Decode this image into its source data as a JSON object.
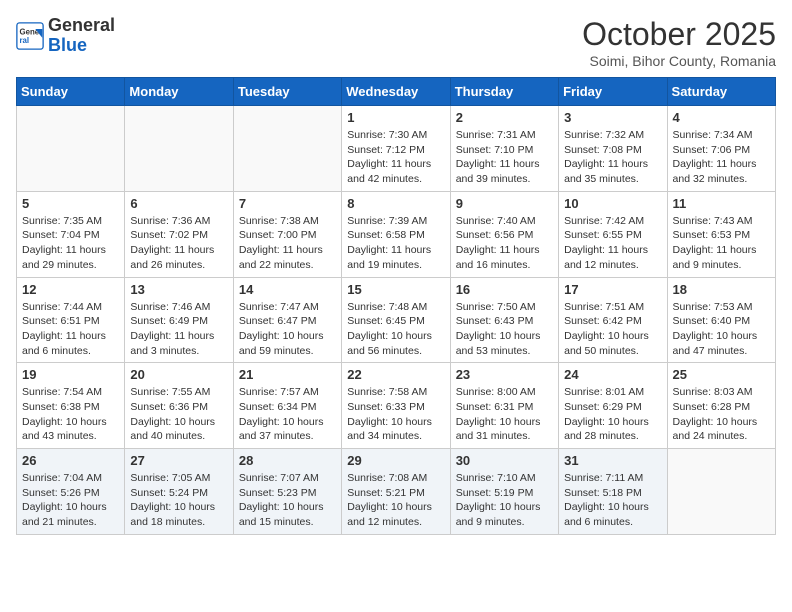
{
  "header": {
    "logo_general": "General",
    "logo_blue": "Blue",
    "month_title": "October 2025",
    "subtitle": "Soimi, Bihor County, Romania"
  },
  "weekdays": [
    "Sunday",
    "Monday",
    "Tuesday",
    "Wednesday",
    "Thursday",
    "Friday",
    "Saturday"
  ],
  "weeks": [
    [
      {
        "day": "",
        "info": ""
      },
      {
        "day": "",
        "info": ""
      },
      {
        "day": "",
        "info": ""
      },
      {
        "day": "1",
        "info": "Sunrise: 7:30 AM\nSunset: 7:12 PM\nDaylight: 11 hours\nand 42 minutes."
      },
      {
        "day": "2",
        "info": "Sunrise: 7:31 AM\nSunset: 7:10 PM\nDaylight: 11 hours\nand 39 minutes."
      },
      {
        "day": "3",
        "info": "Sunrise: 7:32 AM\nSunset: 7:08 PM\nDaylight: 11 hours\nand 35 minutes."
      },
      {
        "day": "4",
        "info": "Sunrise: 7:34 AM\nSunset: 7:06 PM\nDaylight: 11 hours\nand 32 minutes."
      }
    ],
    [
      {
        "day": "5",
        "info": "Sunrise: 7:35 AM\nSunset: 7:04 PM\nDaylight: 11 hours\nand 29 minutes."
      },
      {
        "day": "6",
        "info": "Sunrise: 7:36 AM\nSunset: 7:02 PM\nDaylight: 11 hours\nand 26 minutes."
      },
      {
        "day": "7",
        "info": "Sunrise: 7:38 AM\nSunset: 7:00 PM\nDaylight: 11 hours\nand 22 minutes."
      },
      {
        "day": "8",
        "info": "Sunrise: 7:39 AM\nSunset: 6:58 PM\nDaylight: 11 hours\nand 19 minutes."
      },
      {
        "day": "9",
        "info": "Sunrise: 7:40 AM\nSunset: 6:56 PM\nDaylight: 11 hours\nand 16 minutes."
      },
      {
        "day": "10",
        "info": "Sunrise: 7:42 AM\nSunset: 6:55 PM\nDaylight: 11 hours\nand 12 minutes."
      },
      {
        "day": "11",
        "info": "Sunrise: 7:43 AM\nSunset: 6:53 PM\nDaylight: 11 hours\nand 9 minutes."
      }
    ],
    [
      {
        "day": "12",
        "info": "Sunrise: 7:44 AM\nSunset: 6:51 PM\nDaylight: 11 hours\nand 6 minutes."
      },
      {
        "day": "13",
        "info": "Sunrise: 7:46 AM\nSunset: 6:49 PM\nDaylight: 11 hours\nand 3 minutes."
      },
      {
        "day": "14",
        "info": "Sunrise: 7:47 AM\nSunset: 6:47 PM\nDaylight: 10 hours\nand 59 minutes."
      },
      {
        "day": "15",
        "info": "Sunrise: 7:48 AM\nSunset: 6:45 PM\nDaylight: 10 hours\nand 56 minutes."
      },
      {
        "day": "16",
        "info": "Sunrise: 7:50 AM\nSunset: 6:43 PM\nDaylight: 10 hours\nand 53 minutes."
      },
      {
        "day": "17",
        "info": "Sunrise: 7:51 AM\nSunset: 6:42 PM\nDaylight: 10 hours\nand 50 minutes."
      },
      {
        "day": "18",
        "info": "Sunrise: 7:53 AM\nSunset: 6:40 PM\nDaylight: 10 hours\nand 47 minutes."
      }
    ],
    [
      {
        "day": "19",
        "info": "Sunrise: 7:54 AM\nSunset: 6:38 PM\nDaylight: 10 hours\nand 43 minutes."
      },
      {
        "day": "20",
        "info": "Sunrise: 7:55 AM\nSunset: 6:36 PM\nDaylight: 10 hours\nand 40 minutes."
      },
      {
        "day": "21",
        "info": "Sunrise: 7:57 AM\nSunset: 6:34 PM\nDaylight: 10 hours\nand 37 minutes."
      },
      {
        "day": "22",
        "info": "Sunrise: 7:58 AM\nSunset: 6:33 PM\nDaylight: 10 hours\nand 34 minutes."
      },
      {
        "day": "23",
        "info": "Sunrise: 8:00 AM\nSunset: 6:31 PM\nDaylight: 10 hours\nand 31 minutes."
      },
      {
        "day": "24",
        "info": "Sunrise: 8:01 AM\nSunset: 6:29 PM\nDaylight: 10 hours\nand 28 minutes."
      },
      {
        "day": "25",
        "info": "Sunrise: 8:03 AM\nSunset: 6:28 PM\nDaylight: 10 hours\nand 24 minutes."
      }
    ],
    [
      {
        "day": "26",
        "info": "Sunrise: 7:04 AM\nSunset: 5:26 PM\nDaylight: 10 hours\nand 21 minutes."
      },
      {
        "day": "27",
        "info": "Sunrise: 7:05 AM\nSunset: 5:24 PM\nDaylight: 10 hours\nand 18 minutes."
      },
      {
        "day": "28",
        "info": "Sunrise: 7:07 AM\nSunset: 5:23 PM\nDaylight: 10 hours\nand 15 minutes."
      },
      {
        "day": "29",
        "info": "Sunrise: 7:08 AM\nSunset: 5:21 PM\nDaylight: 10 hours\nand 12 minutes."
      },
      {
        "day": "30",
        "info": "Sunrise: 7:10 AM\nSunset: 5:19 PM\nDaylight: 10 hours\nand 9 minutes."
      },
      {
        "day": "31",
        "info": "Sunrise: 7:11 AM\nSunset: 5:18 PM\nDaylight: 10 hours\nand 6 minutes."
      },
      {
        "day": "",
        "info": ""
      }
    ]
  ]
}
